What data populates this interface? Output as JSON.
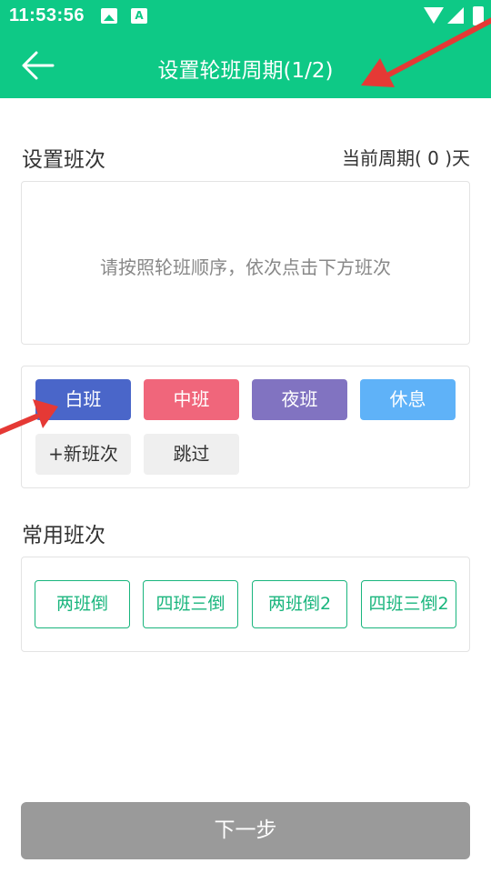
{
  "status_bar": {
    "time": "11:53:56",
    "icons": [
      "image-icon",
      "a-badge-icon",
      "wifi-icon",
      "signal-icon",
      "battery-icon"
    ]
  },
  "app_bar": {
    "title": "设置轮班周期(1/2)",
    "back_icon": "arrow-left-icon"
  },
  "shift_section": {
    "title": "设置班次",
    "cycle_label": "当前周期( 0 )天",
    "hint": "请按照轮班顺序，依次点击下方班次",
    "shifts": [
      {
        "label": "白班",
        "color": "#4a66c9"
      },
      {
        "label": "中班",
        "color": "#f0667b"
      },
      {
        "label": "夜班",
        "color": "#8173c1"
      },
      {
        "label": "休息",
        "color": "#5fb2f8"
      }
    ],
    "actions": [
      {
        "label": "+新班次"
      },
      {
        "label": "跳过"
      }
    ]
  },
  "common_section": {
    "title": "常用班次",
    "patterns": [
      {
        "label": "两班倒"
      },
      {
        "label": "四班三倒"
      },
      {
        "label": "两班倒2"
      },
      {
        "label": "四班三倒2"
      }
    ]
  },
  "footer": {
    "next_label": "下一步"
  },
  "colors": {
    "primary": "#0ec986",
    "pattern_border": "#19b57d",
    "next_button": "#9a9a9a",
    "annotation_arrow": "#e53935"
  }
}
